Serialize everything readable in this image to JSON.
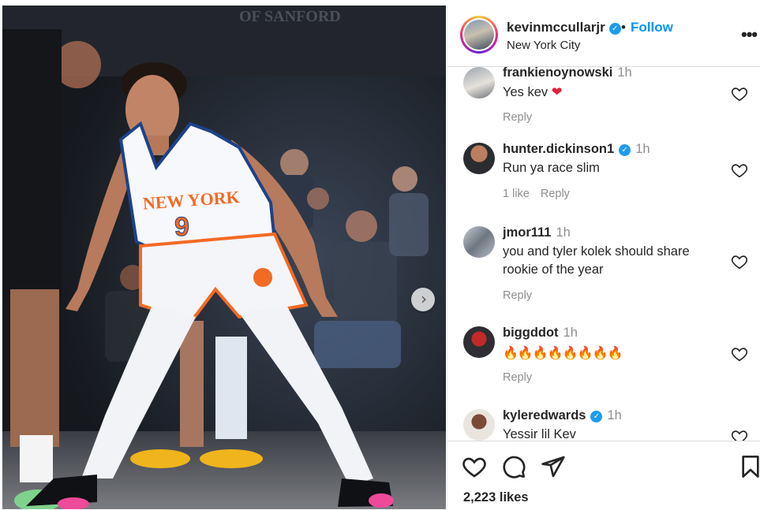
{
  "post": {
    "username": "kevinmccullarjr",
    "follow_label": "Follow",
    "separator": "•",
    "location": "New York City",
    "more_label": "•••",
    "likes": "2,223 likes"
  },
  "photo": {
    "jersey_text": "NEW YORK",
    "jersey_number": "9",
    "next_label": "›"
  },
  "comments": [
    {
      "user": "frankienoynowski",
      "time": "1h",
      "text": "Yes kev",
      "has_heart_emoji": true,
      "meta_likes": "",
      "reply_label": "Reply",
      "verified": false
    },
    {
      "user": "hunter.dickinson1",
      "time": "1h",
      "text": "Run ya race slim",
      "meta_likes": "1 like",
      "reply_label": "Reply",
      "verified": true
    },
    {
      "user": "jmor111",
      "time": "1h",
      "text": "you and tyler kolek should share rookie of the year",
      "meta_likes": "",
      "reply_label": "Reply",
      "verified": false
    },
    {
      "user": "biggddot",
      "time": "1h",
      "text": "🔥🔥🔥🔥🔥🔥🔥🔥",
      "meta_likes": "",
      "reply_label": "Reply",
      "verified": false
    },
    {
      "user": "kyleredwards",
      "time": "1h",
      "text": "Yessir lil Kev",
      "meta_likes": "",
      "reply_label": "",
      "verified": true
    }
  ],
  "colors": {
    "follow": "#0095f6",
    "verified": "#1d9bf0",
    "muted": "#8e8e8e",
    "knicks_orange": "#f26a24",
    "knicks_blue": "#1d428a"
  },
  "icons": {
    "verified": "verified-badge-icon",
    "heart": "heart-icon",
    "comment": "comment-icon",
    "share": "send-icon",
    "save": "bookmark-icon",
    "next": "chevron-right-icon"
  }
}
